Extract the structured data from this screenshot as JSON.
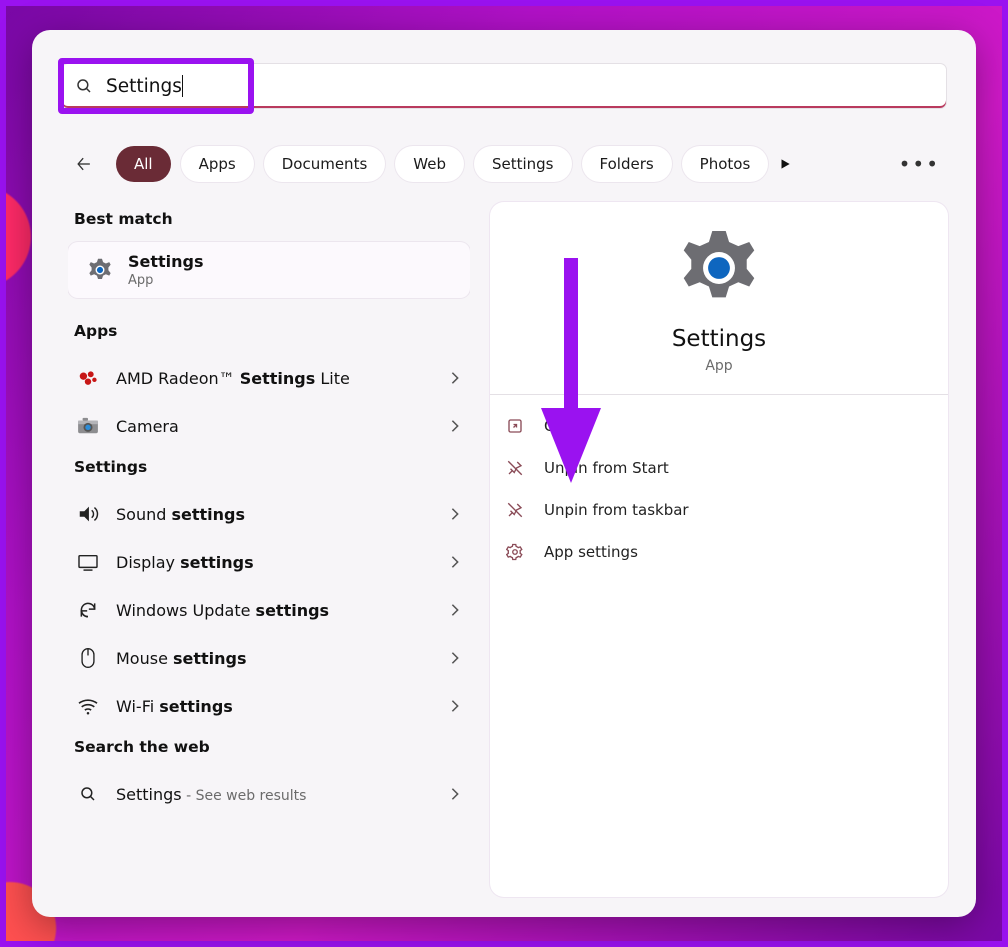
{
  "search": {
    "query": "Settings",
    "icon": "search-icon"
  },
  "filters": {
    "items": [
      {
        "label": "All",
        "active": true
      },
      {
        "label": "Apps",
        "active": false
      },
      {
        "label": "Documents",
        "active": false
      },
      {
        "label": "Web",
        "active": false
      },
      {
        "label": "Settings",
        "active": false
      },
      {
        "label": "Folders",
        "active": false
      },
      {
        "label": "Photos",
        "active": false,
        "cut": true
      }
    ],
    "overflow_icon": "play-icon",
    "more_icon": "more-icon"
  },
  "sections": {
    "best_match": {
      "heading": "Best match",
      "item": {
        "title": "Settings",
        "subtitle": "App",
        "icon": "gear-icon"
      }
    },
    "apps": {
      "heading": "Apps",
      "items": [
        {
          "icon": "amd-icon",
          "prefix": "AMD Radeon™ ",
          "bold": "Settings",
          "suffix": " Lite"
        },
        {
          "icon": "camera-icon",
          "prefix": "Camera",
          "bold": "",
          "suffix": ""
        }
      ]
    },
    "settings": {
      "heading": "Settings",
      "items": [
        {
          "icon": "sound-icon",
          "prefix": "Sound ",
          "bold": "settings",
          "suffix": ""
        },
        {
          "icon": "display-icon",
          "prefix": "Display ",
          "bold": "settings",
          "suffix": ""
        },
        {
          "icon": "update-icon",
          "prefix": "Windows Update ",
          "bold": "settings",
          "suffix": ""
        },
        {
          "icon": "mouse-icon",
          "prefix": "Mouse ",
          "bold": "settings",
          "suffix": ""
        },
        {
          "icon": "wifi-icon",
          "prefix": "Wi-Fi ",
          "bold": "settings",
          "suffix": ""
        }
      ]
    },
    "web": {
      "heading": "Search the web",
      "item": {
        "icon": "search-icon",
        "label": "Settings",
        "sub": " - See web results"
      }
    }
  },
  "details": {
    "title": "Settings",
    "subtitle": "App",
    "actions": [
      {
        "icon": "open-icon",
        "label": "Open"
      },
      {
        "icon": "unpin-icon",
        "label": "Unpin from Start"
      },
      {
        "icon": "unpin-icon",
        "label": "Unpin from taskbar"
      },
      {
        "icon": "gear-outline-icon",
        "label": "App settings"
      }
    ]
  },
  "annotations": {
    "arrow_color": "#9a12f0",
    "highlight_color": "#9a12f0"
  }
}
